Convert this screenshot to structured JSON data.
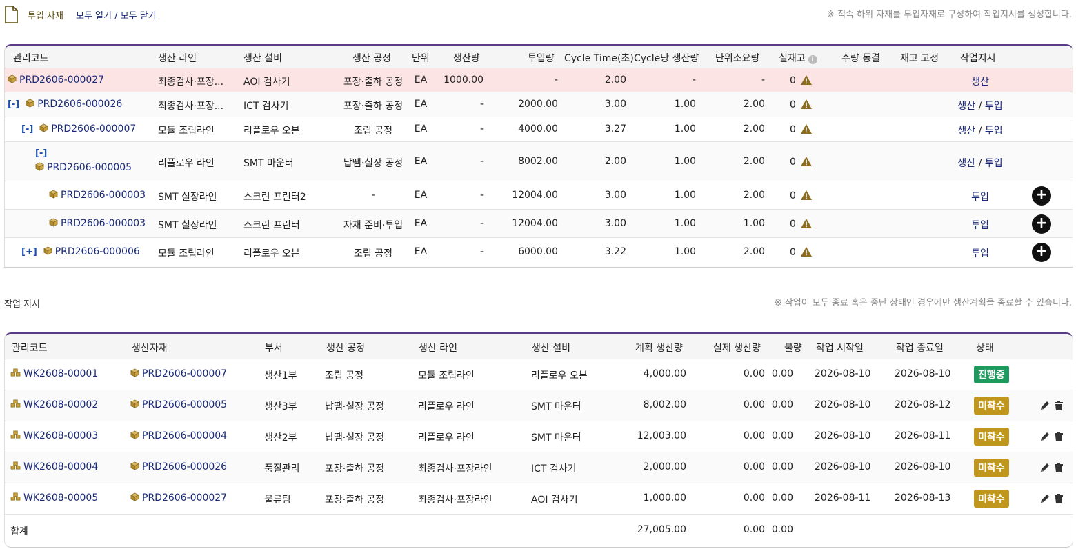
{
  "header": {
    "title": "투입 자재",
    "expand_all": "모두 열기",
    "separator": "/",
    "collapse_all": "모두 닫기",
    "note": "※ 직속 하위 자재를 투입자재로 구성하여 작업지시를 생성합니다."
  },
  "materials": {
    "columns": [
      "관리코드",
      "생산 라인",
      "생산 설비",
      "생산 공정",
      "단위",
      "생산량",
      "투입량",
      "Cycle Time(초)",
      "Cycle당 생산량",
      "단위소요량",
      "실재고",
      "수량 동결",
      "재고 고정",
      "작업지시"
    ],
    "rows": [
      {
        "toggle": "",
        "code": "PRD2606-000027",
        "line": "최종검사·포장...",
        "equip": "AOI 검사기",
        "process": "포장·출하 공정",
        "unit": "EA",
        "prod": "1000.00",
        "input": "-",
        "cycle": "2.00",
        "per_cycle": "-",
        "unit_req": "-",
        "stock": "0",
        "wo1": "생산",
        "wo_sep": "",
        "wo2": ""
      },
      {
        "toggle": "[-]",
        "code": "PRD2606-000026",
        "line": "최종검사·포장...",
        "equip": "ICT 검사기",
        "process": "포장·출하 공정",
        "unit": "EA",
        "prod": "-",
        "input": "2000.00",
        "cycle": "3.00",
        "per_cycle": "1.00",
        "unit_req": "2.00",
        "stock": "0",
        "wo1": "생산",
        "wo_sep": "/",
        "wo2": "투입"
      },
      {
        "toggle": "[-]",
        "code": "PRD2606-000007",
        "line": "모듈 조립라인",
        "equip": "리플로우 오븐",
        "process": "조립 공정",
        "unit": "EA",
        "prod": "-",
        "input": "4000.00",
        "cycle": "3.27",
        "per_cycle": "1.00",
        "unit_req": "2.00",
        "stock": "0",
        "wo1": "생산",
        "wo_sep": "/",
        "wo2": "투입"
      },
      {
        "toggle": "[-]",
        "code": "PRD2606-000005",
        "line": "리플로우 라인",
        "equip": "SMT 마운터",
        "process": "납땜·실장 공정",
        "unit": "EA",
        "prod": "-",
        "input": "8002.00",
        "cycle": "2.00",
        "per_cycle": "1.00",
        "unit_req": "2.00",
        "stock": "0",
        "wo1": "생산",
        "wo_sep": "/",
        "wo2": "투입"
      },
      {
        "toggle": "",
        "code": "PRD2606-000003",
        "line": "SMT 실장라인",
        "equip": "스크린 프린터2",
        "process": "-",
        "unit": "EA",
        "prod": "-",
        "input": "12004.00",
        "cycle": "3.00",
        "per_cycle": "1.00",
        "unit_req": "2.00",
        "stock": "0",
        "wo1": "투입",
        "wo_sep": "",
        "wo2": ""
      },
      {
        "toggle": "",
        "code": "PRD2606-000003",
        "line": "SMT 실장라인",
        "equip": "스크린 프린터",
        "process": "자재 준비·투입",
        "unit": "EA",
        "prod": "-",
        "input": "12004.00",
        "cycle": "3.00",
        "per_cycle": "1.00",
        "unit_req": "1.00",
        "stock": "0",
        "wo1": "투입",
        "wo_sep": "",
        "wo2": ""
      },
      {
        "toggle": "[+]",
        "code": "PRD2606-000006",
        "line": "모듈 조립라인",
        "equip": "리플로우 오븐",
        "process": "조립 공정",
        "unit": "EA",
        "prod": "-",
        "input": "6000.00",
        "cycle": "3.22",
        "per_cycle": "1.00",
        "unit_req": "2.00",
        "stock": "0",
        "wo1": "투입",
        "wo_sep": "",
        "wo2": ""
      }
    ],
    "info_icon": "i",
    "plus": "+"
  },
  "work_orders": {
    "title": "작업 지시",
    "note": "※ 작업이 모두 종료 혹은 중단 상태인 경우에만 생산계획을 종료할 수 있습니다.",
    "columns": [
      "관리코드",
      "생산자재",
      "부서",
      "생산 공정",
      "생산 라인",
      "생산 설비",
      "계획 생산량",
      "실제 생산량",
      "불량",
      "작업 시작일",
      "작업 종료일",
      "상태"
    ],
    "rows": [
      {
        "code": "WK2608-00001",
        "material": "PRD2606-000007",
        "dept": "생산1부",
        "process": "조립 공정",
        "line": "모듈 조립라인",
        "equip": "리플로우 오븐",
        "planned": "4,000.00",
        "actual": "0.00",
        "defect": "0.00",
        "start": "2026-08-10",
        "end": "2026-08-10",
        "status": "진행중",
        "status_color": "#1f9a5f"
      },
      {
        "code": "WK2608-00002",
        "material": "PRD2606-000005",
        "dept": "생산3부",
        "process": "납땜·실장 공정",
        "line": "리플로우 라인",
        "equip": "SMT 마운터",
        "planned": "8,002.00",
        "actual": "0.00",
        "defect": "0.00",
        "start": "2026-08-10",
        "end": "2026-08-12",
        "status": "미착수",
        "status_color": "#c0961c"
      },
      {
        "code": "WK2608-00003",
        "material": "PRD2606-000004",
        "dept": "생산2부",
        "process": "납땜·실장 공정",
        "line": "리플로우 라인",
        "equip": "SMT 마운터",
        "planned": "12,003.00",
        "actual": "0.00",
        "defect": "0.00",
        "start": "2026-08-10",
        "end": "2026-08-11",
        "status": "미착수",
        "status_color": "#c0961c"
      },
      {
        "code": "WK2608-00004",
        "material": "PRD2606-000026",
        "dept": "품질관리",
        "process": "포장·출하 공정",
        "line": "최종검사·포장라인",
        "equip": "ICT 검사기",
        "planned": "2,000.00",
        "actual": "0.00",
        "defect": "0.00",
        "start": "2026-08-10",
        "end": "2026-08-10",
        "status": "미착수",
        "status_color": "#c0961c"
      },
      {
        "code": "WK2608-00005",
        "material": "PRD2606-000027",
        "dept": "물류팀",
        "process": "포장·출하 공정",
        "line": "최종검사·포장라인",
        "equip": "AOI 검사기",
        "planned": "1,000.00",
        "actual": "0.00",
        "defect": "0.00",
        "start": "2026-08-11",
        "end": "2026-08-13",
        "status": "미착수",
        "status_color": "#c0961c"
      }
    ],
    "total": {
      "label": "합계",
      "planned": "27,005.00",
      "actual": "0.00",
      "defect": "0.00"
    }
  }
}
